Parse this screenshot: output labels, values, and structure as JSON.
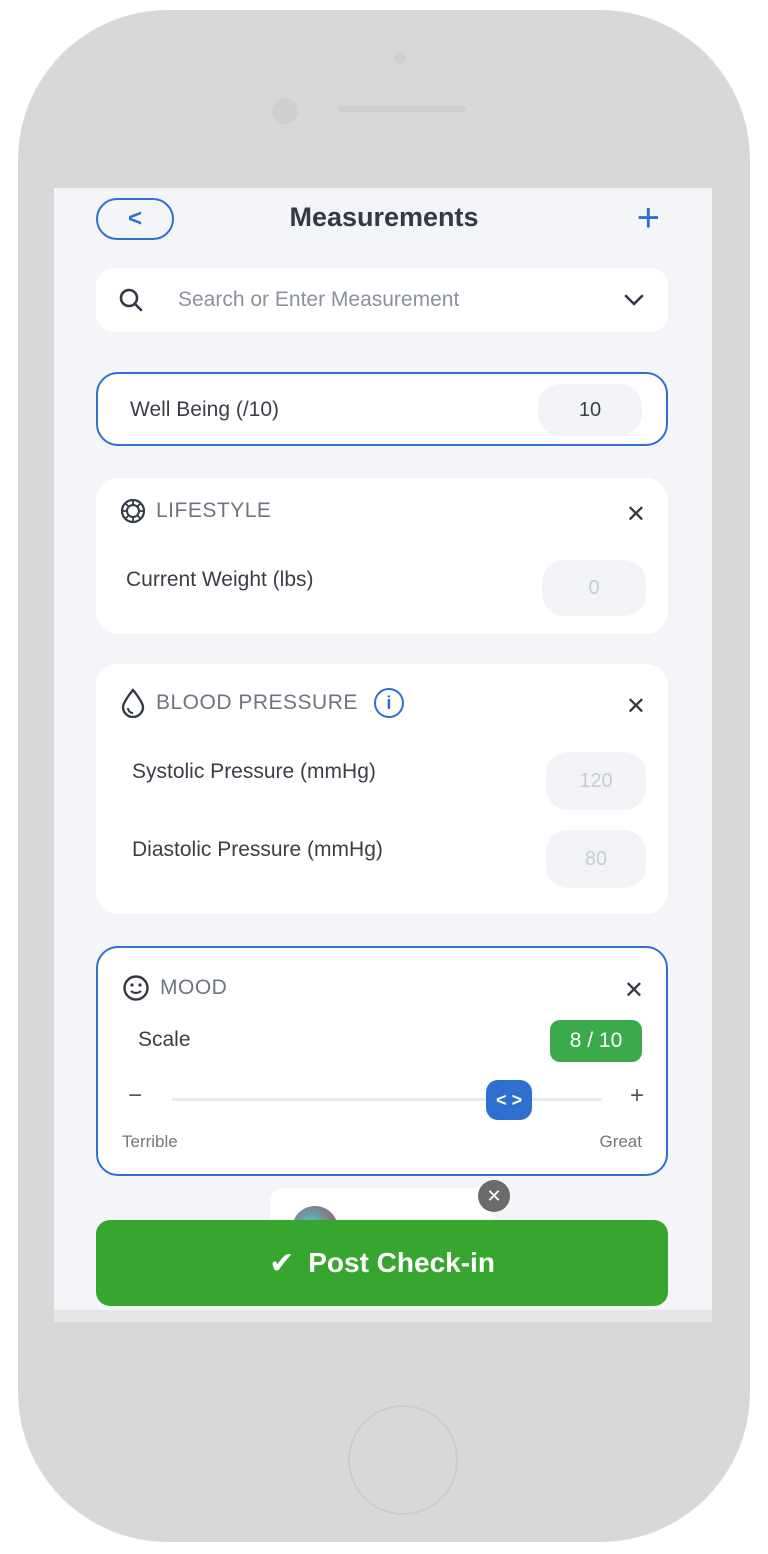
{
  "header": {
    "back_icon": "chevron-left-icon",
    "title": "Measurements",
    "add_icon": "plus-icon"
  },
  "search": {
    "placeholder": "Search or Enter Measurement",
    "icon": "search-icon",
    "dropdown_icon": "chevron-down-icon"
  },
  "well_being": {
    "label": "Well Being (/10)",
    "value": "10"
  },
  "lifestyle": {
    "title": "LIFESTYLE",
    "icon": "lifestyle-icon",
    "fields": [
      {
        "label": "Current Weight (lbs)",
        "placeholder": "0"
      }
    ]
  },
  "blood_pressure": {
    "title": "BLOOD PRESSURE",
    "icon": "drop-icon",
    "info_icon": "info-icon",
    "fields": [
      {
        "label": "Systolic Pressure (mmHg)",
        "placeholder": "120"
      },
      {
        "label": "Diastolic Pressure (mmHg)",
        "placeholder": "80"
      }
    ]
  },
  "mood": {
    "title": "MOOD",
    "icon": "smiley-icon",
    "scale_label": "Scale",
    "score": "8 / 10",
    "slider_value": 8,
    "slider_max": 10,
    "min_label": "Terrible",
    "max_label": "Great",
    "minus": "−",
    "plus": "+"
  },
  "close_symbol": "✕",
  "post_button": {
    "label": "Post Check-in",
    "check": "✔"
  },
  "colors": {
    "accent": "#2f6fd0",
    "success": "#37a62f",
    "badge": "#3aaa4a"
  }
}
